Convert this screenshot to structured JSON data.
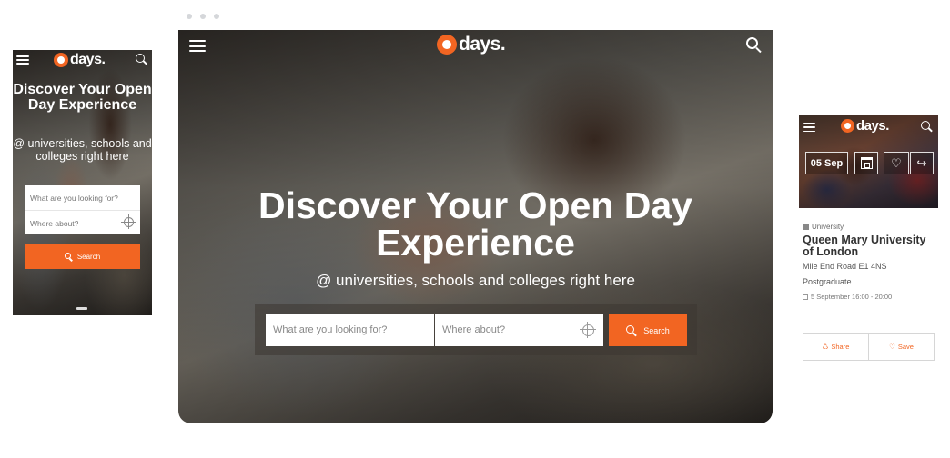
{
  "brand": {
    "logo_text": "days.",
    "accent": "#f26522"
  },
  "phone": {
    "headline": "Discover Your Open Day Experience",
    "subline": "@ universities, schools and colleges right here",
    "search": {
      "what_placeholder": "What are you looking for?",
      "where_placeholder": "Where about?",
      "button_label": "Search"
    }
  },
  "desktop": {
    "headline_line1": "Discover Your Open Day",
    "headline_line2": "Experience",
    "subline": "@ universities, schools and colleges right here",
    "search": {
      "what_placeholder": "What are you looking for?",
      "where_placeholder": "Where about?",
      "button_label": "Search"
    }
  },
  "card": {
    "date": "05 Sep",
    "type": "University",
    "name": "Queen Mary University of London",
    "address": "Mile End Road E1 4NS",
    "level": "Postgraduate",
    "when": "5 September 16:00 - 20:00",
    "share_label": "Share",
    "save_label": "Save"
  }
}
